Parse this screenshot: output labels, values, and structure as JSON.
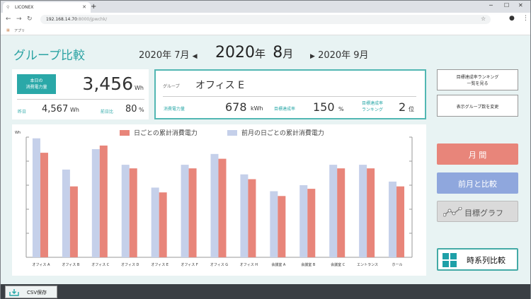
{
  "browser": {
    "tab_title": "LICONEX",
    "url_host": "192.168.14.70",
    "url_rest": ":8000/jpwchk/",
    "bookmark": "アプリ"
  },
  "header": {
    "title": "グループ比較",
    "prev_month": "2020年 7月",
    "current_year": "2020",
    "nen": "年",
    "current_month": "8",
    "tsuki": "月",
    "next_month": "2020年 9月"
  },
  "today_card": {
    "label_line1": "本日の",
    "label_line2": "消費電力量",
    "value": "3,456",
    "unit": "Wh",
    "yesterday_label": "昨日",
    "yesterday_value": "4,567",
    "yesterday_unit": "Wh",
    "ratio_label": "前日比",
    "ratio_value": "80",
    "ratio_unit": "%"
  },
  "group_card": {
    "group_label": "グループ",
    "group_name": "オフィス E",
    "consumption_label": "消費電力量",
    "consumption_value": "678",
    "consumption_unit": "kWh",
    "target_label": "目標達成率",
    "target_value": "150",
    "target_unit": "%",
    "rank_label_1": "目標達成率",
    "rank_label_2": "ランキング",
    "rank_value": "2",
    "rank_unit": "位"
  },
  "side_buttons": {
    "ranking_line1": "目標達成率ランキング",
    "ranking_line2": "一覧を見る",
    "change_groups": "表示グループ数を変更",
    "monthly": "月 間",
    "compare_prev": "前月と比較",
    "target_graph": "目標グラフ",
    "timeseries": "時系列比較"
  },
  "footer": {
    "csv": "CSV保存"
  },
  "chart_data": {
    "type": "bar",
    "ylabel": "Wh",
    "ylim": [
      0,
      100
    ],
    "grid": false,
    "legend_position": "top-center",
    "categories": [
      "オフィス A",
      "オフィス B",
      "オフィス C",
      "オフィス D",
      "オフィス E",
      "オフィス F",
      "オフィス G",
      "オフィス H",
      "会議室 A",
      "会議室 B",
      "会議室 C",
      "エントランス",
      "ホール"
    ],
    "series": [
      {
        "name": "前月の日ごとの累計消費電力",
        "color": "#c5d0ea",
        "values": [
          99,
          73,
          90,
          77,
          58,
          77,
          86,
          69,
          55,
          60,
          77,
          77,
          63
        ]
      },
      {
        "name": "日ごとの累計消費電力",
        "color": "#e8857a",
        "values": [
          87,
          59,
          93,
          74,
          54,
          74,
          82,
          65,
          51,
          57,
          74,
          74,
          59
        ]
      }
    ]
  }
}
